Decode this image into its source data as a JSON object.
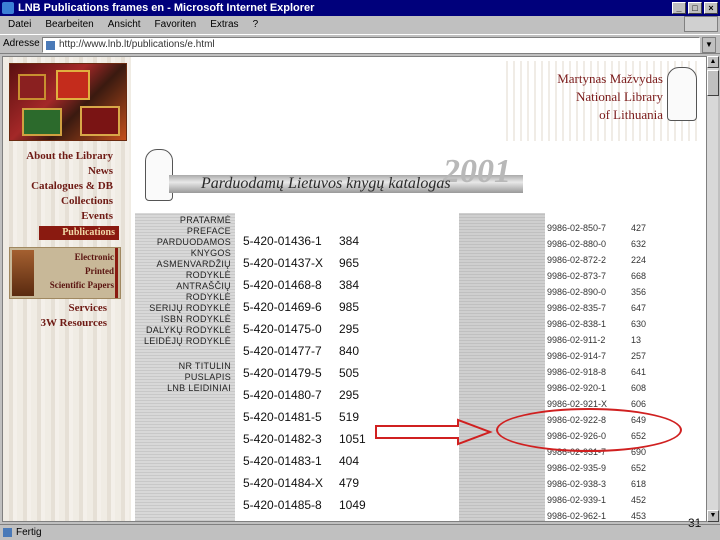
{
  "window": {
    "title": "LNB Publications frames en - Microsoft Internet Explorer",
    "controls": [
      "_",
      "□",
      "×"
    ]
  },
  "menu": [
    "Datei",
    "Bearbeiten",
    "Ansicht",
    "Favoriten",
    "Extras",
    "?"
  ],
  "address": {
    "label": "Adresse",
    "url": "http://www.lnb.lt/publications/e.html",
    "go": "▼"
  },
  "logo": {
    "lines": [
      "Martynas Mažvydas",
      "National Library",
      "of Lithuania"
    ]
  },
  "nav": {
    "items": [
      "About the Library",
      "News",
      "Catalogues & DB",
      "Collections",
      "Events"
    ],
    "active": "Publications",
    "sub": [
      "Electronic",
      "Printed",
      "Scientific Papers"
    ],
    "lower": [
      "Services",
      "3W Resources"
    ]
  },
  "banner": {
    "year": "2001",
    "title": "Parduodamų Lietuvos knygų katalogas"
  },
  "field_labels": [
    "PRATARMĖ",
    "PREFACE",
    "PARDUODAMOS",
    "KNYGOS",
    "ASMENVARDŽIŲ",
    "RODYKLĖ",
    "ANTRAŠČIŲ",
    "RODYKLĖ",
    "SERIJŲ RODYKLĖ",
    "ISBN RODYKLĖ",
    "DALYKŲ RODYKLĖ",
    "LEIDĖJŲ RODYKLĖ",
    "",
    "NR TITULIN",
    "PUSLAPIS",
    "LNB LEIDINIAI"
  ],
  "isbn_rows": [
    {
      "isbn": "5-420-01436-1",
      "count": "384"
    },
    {
      "isbn": "5-420-01437-X",
      "count": "965"
    },
    {
      "isbn": "5-420-01468-8",
      "count": "384"
    },
    {
      "isbn": "5-420-01469-6",
      "count": "985"
    },
    {
      "isbn": "5-420-01475-0",
      "count": "295"
    },
    {
      "isbn": "5-420-01477-7",
      "count": "840"
    },
    {
      "isbn": "5-420-01479-5",
      "count": "505"
    },
    {
      "isbn": "5-420-01480-7",
      "count": "295"
    },
    {
      "isbn": "5-420-01481-5",
      "count": "519"
    },
    {
      "isbn": "5-420-01482-3",
      "count": "1051"
    },
    {
      "isbn": "5-420-01483-1",
      "count": "404"
    },
    {
      "isbn": "5-420-01484-X",
      "count": "479"
    },
    {
      "isbn": "5-420-01485-8",
      "count": "1049"
    }
  ],
  "right_rows": [
    {
      "code": "9986-02-850-7",
      "val": "427"
    },
    {
      "code": "9986-02-880-0",
      "val": "632"
    },
    {
      "code": "9986-02-872-2",
      "val": "224"
    },
    {
      "code": "9986-02-873-7",
      "val": "668"
    },
    {
      "code": "9986-02-890-0",
      "val": "356"
    },
    {
      "code": "9986-02-835-7",
      "val": "647"
    },
    {
      "code": "9986-02-838-1",
      "val": "630"
    },
    {
      "code": "9986-02-911-2",
      "val": "13"
    },
    {
      "code": "9986-02-914-7",
      "val": "257"
    },
    {
      "code": "9986-02-918-8",
      "val": "641"
    },
    {
      "code": "9986-02-920-1",
      "val": "608"
    },
    {
      "code": "9986-02-921-X",
      "val": "606"
    },
    {
      "code": "9986-02-922-8",
      "val": "649"
    },
    {
      "code": "9986-02-926-0",
      "val": "652"
    },
    {
      "code": "9986-02-931-7",
      "val": "690"
    },
    {
      "code": "9986-02-935-9",
      "val": "652"
    },
    {
      "code": "9986-02-938-3",
      "val": "618"
    },
    {
      "code": "9986-02-939-1",
      "val": "452"
    },
    {
      "code": "9986-02-962-1",
      "val": "453"
    }
  ],
  "annotation": {
    "arrow_color": "#d02020",
    "circle_color": "#d02020"
  },
  "page_number": "31",
  "status": {
    "text": "Fertig"
  },
  "colors": {
    "title_bar": "#00007b",
    "nav_text": "#6e1a14",
    "nav_active_bg": "#8a1a10",
    "logo_text": "#7a1a1a"
  }
}
